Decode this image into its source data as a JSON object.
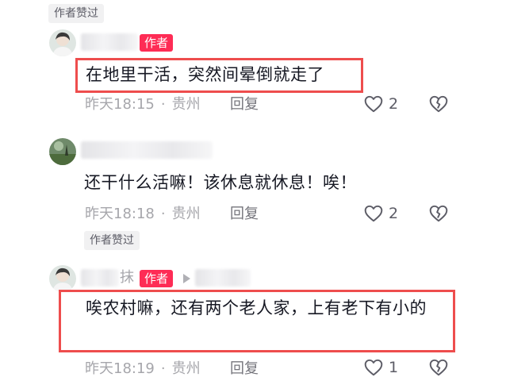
{
  "comments": [
    {
      "liked_label": "作者赞过",
      "author_tag": "作者",
      "name_suffix": "",
      "text": "在地里干活，突然间晕倒就走了",
      "time": "昨天18:15",
      "region": "贵州",
      "reply_label": "回复",
      "likes": "2"
    },
    {
      "text": "还干什么活嘛！该休息就休息！唉！",
      "time": "昨天18:18",
      "region": "贵州",
      "reply_label": "回复",
      "likes": "2"
    },
    {
      "liked_label": "作者赞过",
      "name_suffix": "抹",
      "author_tag": "作者",
      "text": "唉农村嘛，还有两个老人家，上有老下有小的",
      "time": "昨天18:19",
      "region": "贵州",
      "reply_label": "回复",
      "likes": "1"
    }
  ],
  "icons": {
    "like": "heart-outline-icon",
    "dislike": "broken-heart-icon",
    "reply_arrow": "play-arrow-icon"
  },
  "colors": {
    "author_tag": "#fe2c55",
    "highlight_box": "#ee4d4d",
    "meta_text": "#a6a6ab"
  }
}
